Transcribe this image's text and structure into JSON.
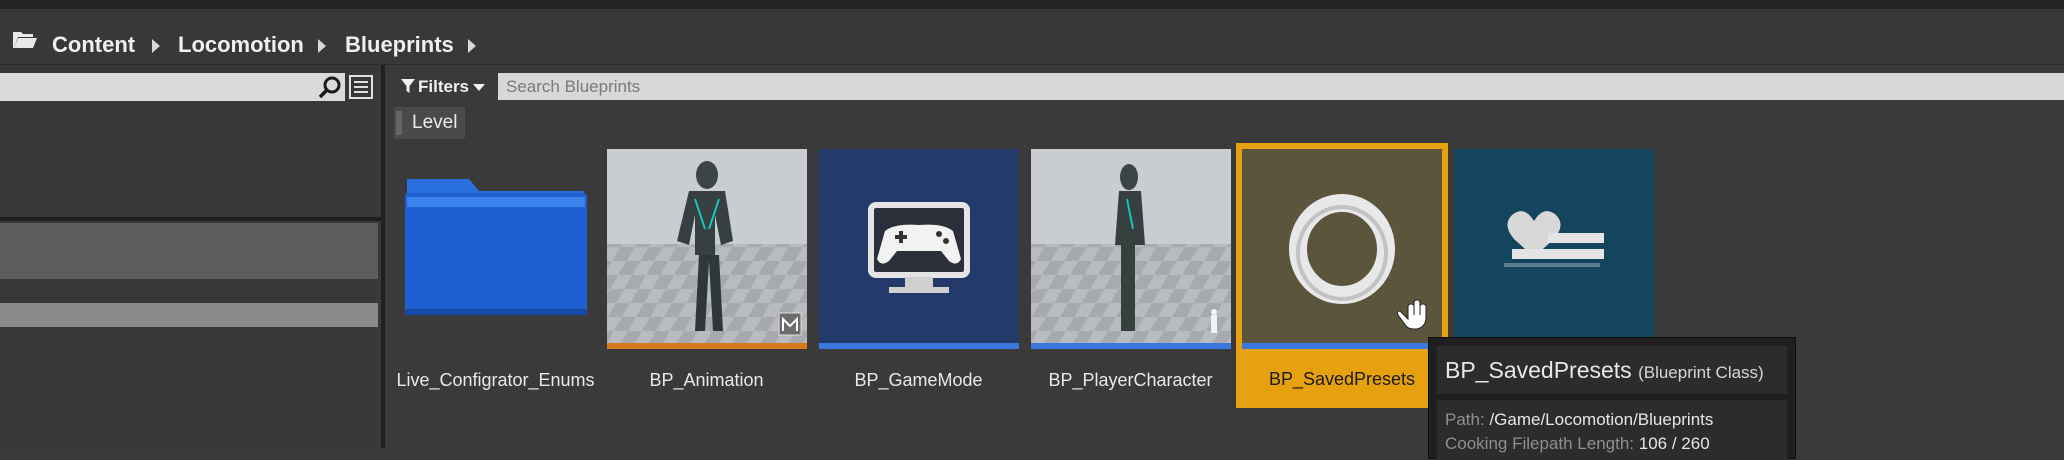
{
  "breadcrumb": {
    "items": [
      "Content",
      "Locomotion",
      "Blueprints"
    ]
  },
  "toolbar": {
    "filters_label": "Filters",
    "search_placeholder": "Search Blueprints",
    "search_value": ""
  },
  "filter_chips": [
    {
      "label": "Level"
    }
  ],
  "assets": [
    {
      "name": "Live_Configrator_Enums",
      "kind": "folder",
      "selected": false
    },
    {
      "name": "BP_Animation",
      "kind": "animation-blueprint",
      "strip_color": "#d87a1a",
      "selected": false
    },
    {
      "name": "BP_GameMode",
      "kind": "blueprint",
      "strip_color": "#3a78e0",
      "selected": false
    },
    {
      "name": "BP_PlayerCharacter",
      "kind": "blueprint",
      "strip_color": "#3a78e0",
      "selected": false
    },
    {
      "name": "BP_SavedPresets",
      "kind": "blueprint",
      "strip_color": "#3a78e0",
      "selected": true
    },
    {
      "name": "",
      "kind": "blueprint",
      "selected": false
    }
  ],
  "tooltip": {
    "title": "BP_SavedPresets",
    "subtitle": "(Blueprint Class)",
    "path_label": "Path:",
    "path_value": "/Game/Locomotion/Blueprints",
    "cooking_label": "Cooking Filepath Length:",
    "cooking_value": "106 / 260"
  },
  "colors": {
    "selection": "#e6a10f",
    "blueprint_strip": "#3a78e0",
    "anim_strip": "#d87a1a",
    "folder": "#1f5fd0"
  }
}
